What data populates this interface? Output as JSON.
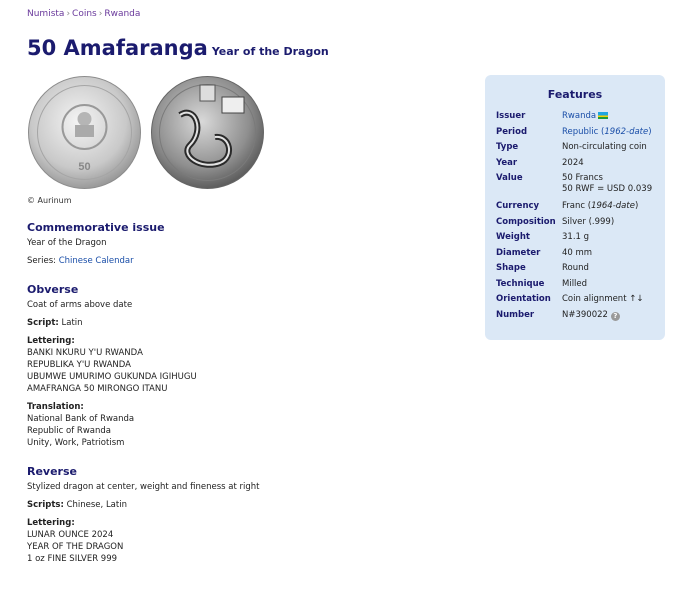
{
  "breadcrumb": [
    "Numista",
    "Coins",
    "Rwanda"
  ],
  "title": {
    "main": "50 Amafaranga",
    "sub": "Year of the Dragon"
  },
  "copyright": "© Aurinum",
  "commemorative": {
    "heading": "Commemorative issue",
    "text": "Year of the Dragon",
    "series_label": "Series:",
    "series_value": "Chinese Calendar"
  },
  "obverse": {
    "heading": "Obverse",
    "description": "Coat of arms above date",
    "script_label": "Script:",
    "script_value": "Latin",
    "lettering_label": "Lettering:",
    "lettering": [
      "BANKI NKURU Y'U RWANDA",
      "REPUBLIKA Y'U RWANDA",
      "UBUMWE UMURIMO GUKUNDA IGIHUGU",
      "AMAFRANGA 50 MIRONGO ITANU"
    ],
    "translation_label": "Translation:",
    "translation": [
      "National Bank of Rwanda",
      "Republic of Rwanda",
      "Unity, Work, Patriotism"
    ]
  },
  "reverse": {
    "heading": "Reverse",
    "description": "Stylized dragon at center, weight and fineness at right",
    "scripts_label": "Scripts:",
    "scripts_value": "Chinese, Latin",
    "lettering_label": "Lettering:",
    "lettering": [
      "LUNAR OUNCE 2024",
      "YEAR OF THE DRAGON",
      "1 oz FINE SILVER 999"
    ]
  },
  "features": {
    "heading": "Features",
    "rows": [
      {
        "key": "Issuer",
        "value": "Rwanda"
      },
      {
        "key": "Period",
        "value": "Republic",
        "value_extra": "1962-date"
      },
      {
        "key": "Type",
        "value": "Non-circulating coin"
      },
      {
        "key": "Year",
        "value": "2024"
      },
      {
        "key": "Value",
        "value": "50 Francs",
        "value_line2": "50 RWF = USD 0.039"
      },
      {
        "key": "Currency",
        "value": "Franc",
        "value_extra": "1964-date"
      },
      {
        "key": "Composition",
        "value": "Silver (.999)"
      },
      {
        "key": "Weight",
        "value": "31.1 g"
      },
      {
        "key": "Diameter",
        "value": "40 mm"
      },
      {
        "key": "Shape",
        "value": "Round"
      },
      {
        "key": "Technique",
        "value": "Milled"
      },
      {
        "key": "Orientation",
        "value": "Coin alignment ↑↓"
      },
      {
        "key": "Number",
        "value": "N#390022"
      }
    ]
  },
  "colors": {
    "accent": "#1b1b6e",
    "link": "#1a4ea8",
    "panel": "#dbe8f6"
  }
}
